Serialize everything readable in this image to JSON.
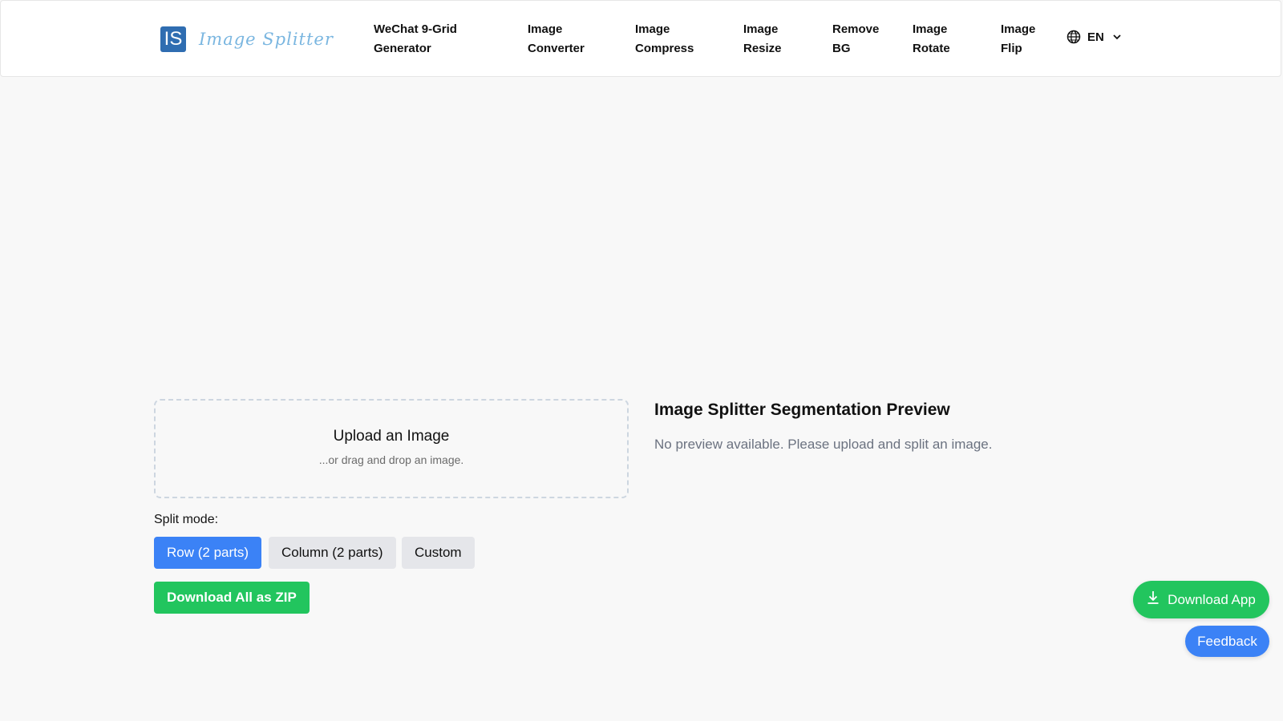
{
  "header": {
    "logo_mark": "IS",
    "logo_text": "Image Splitter",
    "nav": [
      {
        "line1": "WeChat 9-Grid",
        "line2": "Generator"
      },
      {
        "line1": "Image",
        "line2": "Converter"
      },
      {
        "line1": "Image",
        "line2": "Compress"
      },
      {
        "line1": "Image",
        "line2": "Resize"
      },
      {
        "line1": "Remove",
        "line2": "BG"
      },
      {
        "line1": "Image",
        "line2": "Rotate"
      },
      {
        "line1": "Image",
        "line2": "Flip"
      }
    ],
    "language": "EN",
    "language_icon": "globe-icon"
  },
  "upload": {
    "title": "Upload an Image",
    "subtitle": "...or drag and drop an image."
  },
  "split": {
    "label": "Split mode:",
    "modes": [
      {
        "label": "Row (2 parts)",
        "active": true
      },
      {
        "label": "Column (2 parts)",
        "active": false
      },
      {
        "label": "Custom",
        "active": false
      }
    ]
  },
  "actions": {
    "download_zip": "Download All as ZIP"
  },
  "preview": {
    "title": "Image Splitter Segmentation Preview",
    "empty_text": "No preview available. Please upload and split an image."
  },
  "floating": {
    "download_app": "Download App",
    "download_icon": "download-icon",
    "feedback": "Feedback"
  },
  "colors": {
    "primary": "#3b82f6",
    "success": "#22c55e",
    "logo_bg": "#2f6db1",
    "page_bg": "#f8f8f8"
  }
}
